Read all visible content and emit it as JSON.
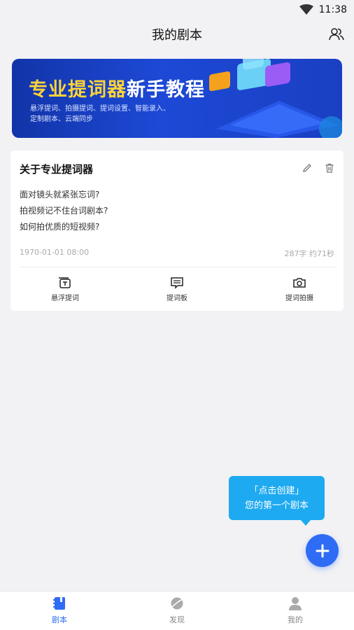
{
  "status": {
    "time": "11:38"
  },
  "header": {
    "title": "我的剧本"
  },
  "banner": {
    "headline_part1": "专业提词器",
    "headline_part2": "新手教程",
    "sub_line1": "悬浮提词、拍摄提词、提词设置、智能录入、",
    "sub_line2": "定制剧本、云端同步"
  },
  "card": {
    "title": "关于专业提词器",
    "lines": [
      "面对镜头就紧张忘词?",
      "拍视频记不住台词剧本?",
      "如何拍优质的短视频?"
    ],
    "date": "1970-01-01 08:00",
    "stats": "287字 约71秒",
    "actions": [
      {
        "label": "悬浮提词",
        "icon": "text-box-icon"
      },
      {
        "label": "提词板",
        "icon": "message-board-icon"
      },
      {
        "label": "提词拍摄",
        "icon": "camera-icon"
      }
    ]
  },
  "tooltip": {
    "line1": "「点击创建」",
    "line2": "您的第一个剧本"
  },
  "tabs": [
    {
      "label": "剧本",
      "icon": "notebook-icon",
      "active": true
    },
    {
      "label": "发现",
      "icon": "planet-icon",
      "active": false
    },
    {
      "label": "我的",
      "icon": "person-icon",
      "active": false
    }
  ],
  "colors": {
    "accent": "#2f6cf5",
    "tooltip": "#1eaaf1",
    "banner_yellow": "#ffd437"
  }
}
